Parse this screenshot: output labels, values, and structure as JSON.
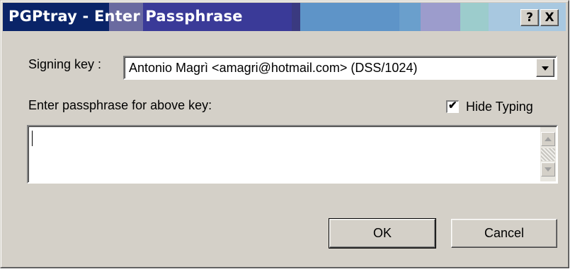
{
  "window": {
    "title": "PGPtray - Enter Passphrase",
    "titlebar_colors": [
      "#0a2468",
      "#6a6aa0",
      "#3a3a98",
      "#3a3a80",
      "#5e94c8",
      "#6a9fcc",
      "#9c9ccc",
      "#9ccccc",
      "#a8c8e0"
    ],
    "help_button_label": "?",
    "close_button_label": "X"
  },
  "signing_key": {
    "label": "Signing key :",
    "selected_value": "Antonio Magrì <amagri@hotmail.com>    (DSS/1024)"
  },
  "passphrase": {
    "label": "Enter passphrase for above key:",
    "hide_typing_label": "Hide Typing",
    "hide_typing_checked": true,
    "value": ""
  },
  "buttons": {
    "ok": "OK",
    "cancel": "Cancel"
  }
}
